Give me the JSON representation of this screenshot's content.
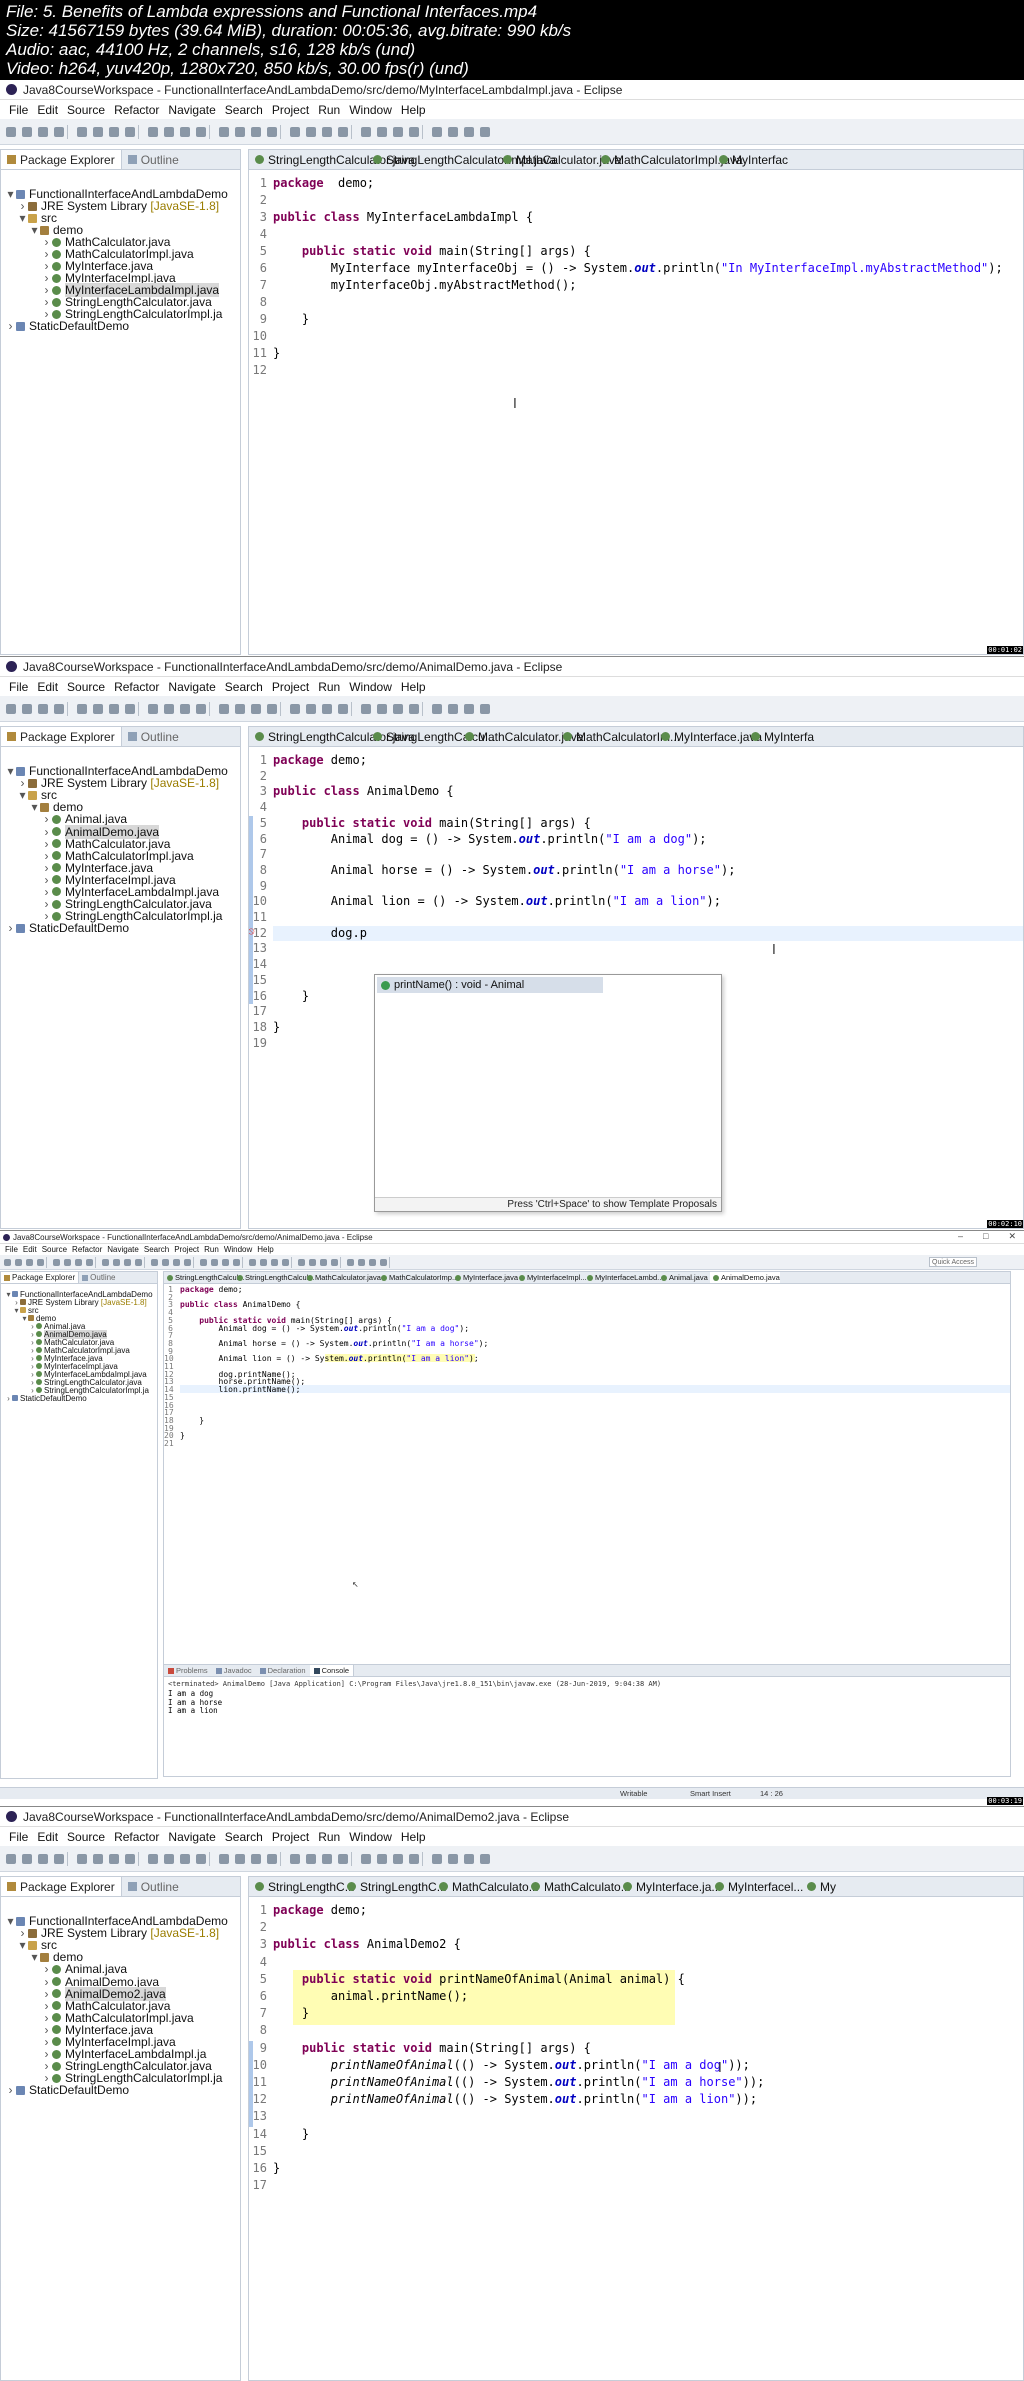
{
  "header": {
    "file": "File: 5. Benefits of Lambda expressions and Functional Interfaces.mp4",
    "size": "Size: 41567159 bytes (39.64 MiB), duration: 00:05:36, avg.bitrate: 990 kb/s",
    "audio": "Audio: aac, 44100 Hz, 2 channels, s16, 128 kb/s (und)",
    "video": "Video: h264, yuv420p, 1280x720, 850 kb/s, 30.00 fps(r) (und)"
  },
  "menu": [
    "File",
    "Edit",
    "Source",
    "Refactor",
    "Navigate",
    "Search",
    "Project",
    "Run",
    "Window",
    "Help"
  ],
  "views": {
    "package_explorer": "Package Explorer",
    "outline": "Outline",
    "problems": "Problems",
    "javadoc": "Javadoc",
    "declaration": "Declaration",
    "console": "Console"
  },
  "frame1": {
    "title": "Java8CourseWorkspace - FunctionalInterfaceAndLambdaDemo/src/demo/MyInterfaceLambdaImpl.java - Eclipse",
    "tabs": [
      "StringLengthCalculator.java",
      "StringLengthCalculatorImpl.java",
      "MathCalculator.java",
      "MathCalculatorImpl.java",
      "MyInterfac"
    ],
    "tree": [
      {
        "d": 0,
        "arrow": "▾",
        "icon": "proj",
        "label": "FunctionalInterfaceAndLambdaDemo"
      },
      {
        "d": 1,
        "arrow": "›",
        "icon": "lib",
        "label": "JRE System Library",
        "sub": "[JavaSE-1.8]"
      },
      {
        "d": 1,
        "arrow": "▾",
        "icon": "src",
        "label": "src"
      },
      {
        "d": 2,
        "arrow": "▾",
        "icon": "pkg",
        "label": "demo"
      },
      {
        "d": 3,
        "arrow": "›",
        "icon": "java",
        "label": "MathCalculator.java"
      },
      {
        "d": 3,
        "arrow": "›",
        "icon": "java",
        "label": "MathCalculatorImpl.java"
      },
      {
        "d": 3,
        "arrow": "›",
        "icon": "java",
        "label": "MyInterface.java"
      },
      {
        "d": 3,
        "arrow": "›",
        "icon": "java",
        "label": "MyInterfaceImpl.java"
      },
      {
        "d": 3,
        "arrow": "›",
        "icon": "java",
        "label": "MyInterfaceLambdaImpl.java",
        "sel": true
      },
      {
        "d": 3,
        "arrow": "›",
        "icon": "java",
        "label": "StringLengthCalculator.java"
      },
      {
        "d": 3,
        "arrow": "›",
        "icon": "java",
        "label": "StringLengthCalculatorImpl.ja"
      },
      {
        "d": 0,
        "arrow": "›",
        "icon": "proj",
        "label": "StaticDefaultDemo"
      }
    ],
    "code": [
      [
        "1",
        [
          [
            "kw",
            "package"
          ],
          [
            "",
            "  demo;"
          ]
        ]
      ],
      [
        "2",
        []
      ],
      [
        "3",
        [
          [
            "kw",
            "public class"
          ],
          [
            "",
            " MyInterfaceLambdaImpl {"
          ]
        ]
      ],
      [
        "4",
        []
      ],
      [
        "5",
        [
          [
            "",
            "    "
          ],
          [
            "kw",
            "public static void"
          ],
          [
            "",
            " main(String[] args) {"
          ]
        ]
      ],
      [
        "6",
        [
          [
            "",
            "        MyInterface myInterfaceObj = () -> System."
          ],
          [
            "fi",
            "out"
          ],
          [
            "",
            ".println("
          ],
          [
            "st",
            "\"In MyInterfaceImpl.myAbstractMethod\""
          ],
          [
            "",
            ");"
          ]
        ]
      ],
      [
        "7",
        [
          [
            "",
            "        myInterfaceObj.myAbstractMethod();"
          ]
        ]
      ],
      [
        "8",
        []
      ],
      [
        "9",
        [
          [
            "",
            "    }"
          ]
        ]
      ],
      [
        "10",
        []
      ],
      [
        "11",
        [
          [
            "",
            "}"
          ]
        ]
      ],
      [
        "12",
        []
      ]
    ],
    "timecode": "00:01:02"
  },
  "frame2": {
    "title": "Java8CourseWorkspace - FunctionalInterfaceAndLambdaDemo/src/demo/AnimalDemo.java - Eclipse",
    "tabs": [
      "StringLengthCalculator.java",
      "StringLengthCalcu...",
      "MathCalculator.java",
      "MathCalculatorIm...",
      "MyInterface.java",
      "MyInterfa"
    ],
    "tree": [
      {
        "d": 0,
        "arrow": "▾",
        "icon": "proj",
        "label": "FunctionalInterfaceAndLambdaDemo"
      },
      {
        "d": 1,
        "arrow": "›",
        "icon": "lib",
        "label": "JRE System Library",
        "sub": "[JavaSE-1.8]"
      },
      {
        "d": 1,
        "arrow": "▾",
        "icon": "src",
        "label": "src"
      },
      {
        "d": 2,
        "arrow": "▾",
        "icon": "pkg",
        "label": "demo"
      },
      {
        "d": 3,
        "arrow": "›",
        "icon": "java",
        "label": "Animal.java"
      },
      {
        "d": 3,
        "arrow": "›",
        "icon": "java",
        "label": "AnimalDemo.java",
        "sel": true
      },
      {
        "d": 3,
        "arrow": "›",
        "icon": "java",
        "label": "MathCalculator.java"
      },
      {
        "d": 3,
        "arrow": "›",
        "icon": "java",
        "label": "MathCalculatorImpl.java"
      },
      {
        "d": 3,
        "arrow": "›",
        "icon": "java",
        "label": "MyInterface.java"
      },
      {
        "d": 3,
        "arrow": "›",
        "icon": "java",
        "label": "MyInterfaceImpl.java"
      },
      {
        "d": 3,
        "arrow": "›",
        "icon": "java",
        "label": "MyInterfaceLambdaImpl.java"
      },
      {
        "d": 3,
        "arrow": "›",
        "icon": "java",
        "label": "StringLengthCalculator.java"
      },
      {
        "d": 3,
        "arrow": "›",
        "icon": "java",
        "label": "StringLengthCalculatorImpl.ja"
      },
      {
        "d": 0,
        "arrow": "›",
        "icon": "proj",
        "label": "StaticDefaultDemo"
      }
    ],
    "code": [
      [
        "1",
        [
          [
            "kw",
            "package"
          ],
          [
            "",
            " demo;"
          ]
        ]
      ],
      [
        "2",
        []
      ],
      [
        "3",
        [
          [
            "kw",
            "public class"
          ],
          [
            "",
            " AnimalDemo {"
          ]
        ]
      ],
      [
        "4",
        []
      ],
      [
        "5",
        [
          [
            "",
            "    "
          ],
          [
            "kw",
            "public static void"
          ],
          [
            "",
            " main(String[] args) {"
          ]
        ]
      ],
      [
        "6",
        [
          [
            "",
            "        Animal dog = () -> System."
          ],
          [
            "fi",
            "out"
          ],
          [
            "",
            ".println("
          ],
          [
            "st",
            "\"I am a dog\""
          ],
          [
            "",
            ");"
          ]
        ]
      ],
      [
        "7",
        []
      ],
      [
        "8",
        [
          [
            "",
            "        Animal horse = () -> System."
          ],
          [
            "fi",
            "out"
          ],
          [
            "",
            ".println("
          ],
          [
            "st",
            "\"I am a horse\""
          ],
          [
            "",
            ");"
          ]
        ]
      ],
      [
        "9",
        []
      ],
      [
        "10",
        [
          [
            "",
            "        Animal lion = () -> System."
          ],
          [
            "fi",
            "out"
          ],
          [
            "",
            ".println("
          ],
          [
            "st",
            "\"I am a lion\""
          ],
          [
            "",
            ");"
          ]
        ]
      ],
      [
        "11",
        []
      ],
      [
        "12",
        [
          [
            "",
            "        dog.p"
          ]
        ]
      ],
      [
        "13",
        []
      ],
      [
        "14",
        []
      ],
      [
        "15",
        []
      ],
      [
        "16",
        [
          [
            "",
            "    }"
          ]
        ]
      ],
      [
        "17",
        []
      ],
      [
        "18",
        [
          [
            "",
            "}"
          ]
        ]
      ],
      [
        "19",
        []
      ]
    ],
    "popup_item": "printName() : void - Animal",
    "popup_footer": "Press 'Ctrl+Space' to show Template Proposals",
    "timecode": "00:02:10"
  },
  "frame3": {
    "title": "Java8CourseWorkspace - FunctionalInterfaceAndLambdaDemo/src/demo/AnimalDemo.java - Eclipse",
    "quick_access": "Quick Access",
    "tabs": [
      "StringLengthCalcul...",
      "StringLengthCalcul...",
      "MathCalculator.java",
      "MathCalculatorImp...",
      "MyInterface.java",
      "MyInterfaceImpl...",
      "MyInterfaceLambd...",
      "Animal.java",
      "AnimalDemo.java"
    ],
    "tree": [
      {
        "d": 0,
        "arrow": "▾",
        "icon": "proj",
        "label": "FunctionalInterfaceAndLambdaDemo"
      },
      {
        "d": 1,
        "arrow": "›",
        "icon": "lib",
        "label": "JRE System Library",
        "sub": "[JavaSE-1.8]"
      },
      {
        "d": 1,
        "arrow": "▾",
        "icon": "src",
        "label": "src"
      },
      {
        "d": 2,
        "arrow": "▾",
        "icon": "pkg",
        "label": "demo"
      },
      {
        "d": 3,
        "arrow": "›",
        "icon": "java",
        "label": "Animal.java"
      },
      {
        "d": 3,
        "arrow": "›",
        "icon": "java",
        "label": "AnimalDemo.java",
        "sel": true
      },
      {
        "d": 3,
        "arrow": "›",
        "icon": "java",
        "label": "MathCalculator.java"
      },
      {
        "d": 3,
        "arrow": "›",
        "icon": "java",
        "label": "MathCalculatorImpl.java"
      },
      {
        "d": 3,
        "arrow": "›",
        "icon": "java",
        "label": "MyInterface.java"
      },
      {
        "d": 3,
        "arrow": "›",
        "icon": "java",
        "label": "MyInterfaceImpl.java"
      },
      {
        "d": 3,
        "arrow": "›",
        "icon": "java",
        "label": "MyInterfaceLambdaImpl.java"
      },
      {
        "d": 3,
        "arrow": "›",
        "icon": "java",
        "label": "StringLengthCalculator.java"
      },
      {
        "d": 3,
        "arrow": "›",
        "icon": "java",
        "label": "StringLengthCalculatorImpl.ja"
      },
      {
        "d": 0,
        "arrow": "›",
        "icon": "proj",
        "label": "StaticDefaultDemo"
      }
    ],
    "code": [
      [
        "1",
        [
          [
            "kw",
            "package"
          ],
          [
            "",
            " demo;"
          ]
        ]
      ],
      [
        "2",
        []
      ],
      [
        "3",
        [
          [
            "kw",
            "public class"
          ],
          [
            "",
            " AnimalDemo {"
          ]
        ]
      ],
      [
        "4",
        []
      ],
      [
        "5",
        [
          [
            "",
            "    "
          ],
          [
            "kw",
            "public static void"
          ],
          [
            "",
            " main(String[] args) {"
          ]
        ]
      ],
      [
        "6",
        [
          [
            "",
            "        Animal dog = () -> System."
          ],
          [
            "fi",
            "out"
          ],
          [
            "",
            ".println("
          ],
          [
            "st",
            "\"I am a dog\""
          ],
          [
            "",
            ");"
          ]
        ]
      ],
      [
        "7",
        []
      ],
      [
        "8",
        [
          [
            "",
            "        Animal horse = () -> System."
          ],
          [
            "fi",
            "out"
          ],
          [
            "",
            ".println("
          ],
          [
            "st",
            "\"I am a horse\""
          ],
          [
            "",
            ");"
          ]
        ]
      ],
      [
        "9",
        []
      ],
      [
        "10",
        [
          [
            "",
            "        Animal lion = () -> System."
          ],
          [
            "fi",
            "out"
          ],
          [
            "",
            ".println("
          ],
          [
            "st",
            "\"I am a lion\""
          ],
          [
            "",
            ");"
          ]
        ]
      ],
      [
        "11",
        []
      ],
      [
        "12",
        [
          [
            "",
            "        dog.printName();"
          ]
        ]
      ],
      [
        "13",
        [
          [
            "",
            "        horse.printName();"
          ]
        ]
      ],
      [
        "14",
        [
          [
            "",
            "        lion.printName();"
          ]
        ]
      ],
      [
        "15",
        []
      ],
      [
        "16",
        []
      ],
      [
        "17",
        []
      ],
      [
        "18",
        [
          [
            "",
            "    }"
          ]
        ]
      ],
      [
        "19",
        []
      ],
      [
        "20",
        [
          [
            "",
            "}"
          ]
        ]
      ],
      [
        "21",
        []
      ]
    ],
    "console_header": "<terminated> AnimalDemo [Java Application] C:\\Program Files\\Java\\jre1.8.0_151\\bin\\javaw.exe (28-Jun-2019, 9:04:38 AM)",
    "console_lines": [
      "I am a dog",
      "I am a horse",
      "I am a lion"
    ],
    "status": [
      "Writable",
      "Smart Insert",
      "14 : 26"
    ],
    "timecode": "00:03:19"
  },
  "frame4": {
    "title": "Java8CourseWorkspace - FunctionalInterfaceAndLambdaDemo/src/demo/AnimalDemo2.java - Eclipse",
    "tabs": [
      "StringLengthC...",
      "StringLengthC...",
      "MathCalculato...",
      "MathCalculato...",
      "MyInterface.ja...",
      "MyInterfacel...",
      "My"
    ],
    "tree": [
      {
        "d": 0,
        "arrow": "▾",
        "icon": "proj",
        "label": "FunctionalInterfaceAndLambdaDemo"
      },
      {
        "d": 1,
        "arrow": "›",
        "icon": "lib",
        "label": "JRE System Library",
        "sub": "[JavaSE-1.8]"
      },
      {
        "d": 1,
        "arrow": "▾",
        "icon": "src",
        "label": "src"
      },
      {
        "d": 2,
        "arrow": "▾",
        "icon": "pkg",
        "label": "demo"
      },
      {
        "d": 3,
        "arrow": "›",
        "icon": "java",
        "label": "Animal.java"
      },
      {
        "d": 3,
        "arrow": "›",
        "icon": "java",
        "label": "AnimalDemo.java"
      },
      {
        "d": 3,
        "arrow": "›",
        "icon": "java",
        "label": "AnimalDemo2.java",
        "sel": true
      },
      {
        "d": 3,
        "arrow": "›",
        "icon": "java",
        "label": "MathCalculator.java"
      },
      {
        "d": 3,
        "arrow": "›",
        "icon": "java",
        "label": "MathCalculatorImpl.java"
      },
      {
        "d": 3,
        "arrow": "›",
        "icon": "java",
        "label": "MyInterface.java"
      },
      {
        "d": 3,
        "arrow": "›",
        "icon": "java",
        "label": "MyInterfaceImpl.java"
      },
      {
        "d": 3,
        "arrow": "›",
        "icon": "java",
        "label": "MyInterfaceLambdaImpl.ja"
      },
      {
        "d": 3,
        "arrow": "›",
        "icon": "java",
        "label": "StringLengthCalculator.java"
      },
      {
        "d": 3,
        "arrow": "›",
        "icon": "java",
        "label": "StringLengthCalculatorImpl.ja"
      },
      {
        "d": 0,
        "arrow": "›",
        "icon": "proj",
        "label": "StaticDefaultDemo"
      }
    ],
    "code": [
      [
        "1",
        [
          [
            "kw",
            "package"
          ],
          [
            "",
            " demo;"
          ]
        ]
      ],
      [
        "2",
        []
      ],
      [
        "3",
        [
          [
            "kw",
            "public class"
          ],
          [
            "",
            " AnimalDemo2 {"
          ]
        ]
      ],
      [
        "4",
        []
      ],
      [
        "5",
        [
          [
            "",
            "    "
          ],
          [
            "kw",
            "public static void"
          ],
          [
            "",
            " printNameOfAnimal(Animal animal) {"
          ]
        ]
      ],
      [
        "6",
        [
          [
            "",
            "        animal.printName();"
          ]
        ]
      ],
      [
        "7",
        [
          [
            "",
            "    }"
          ]
        ]
      ],
      [
        "8",
        []
      ],
      [
        "9",
        [
          [
            "",
            "    "
          ],
          [
            "kw",
            "public static void"
          ],
          [
            "",
            " main(String[] args) {"
          ]
        ]
      ],
      [
        "10",
        [
          [
            "",
            "        "
          ],
          [
            "it",
            "printNameOfAnimal"
          ],
          [
            "",
            "(() -> System."
          ],
          [
            "fi",
            "out"
          ],
          [
            "",
            ".println("
          ],
          [
            "st",
            "\"I am a dog\""
          ],
          [
            "",
            "));"
          ]
        ]
      ],
      [
        "11",
        [
          [
            "",
            "        "
          ],
          [
            "it",
            "printNameOfAnimal"
          ],
          [
            "",
            "(() -> System."
          ],
          [
            "fi",
            "out"
          ],
          [
            "",
            ".println("
          ],
          [
            "st",
            "\"I am a horse\""
          ],
          [
            "",
            "));"
          ]
        ]
      ],
      [
        "12",
        [
          [
            "",
            "        "
          ],
          [
            "it",
            "printNameOfAnimal"
          ],
          [
            "",
            "(() -> System."
          ],
          [
            "fi",
            "out"
          ],
          [
            "",
            ".println("
          ],
          [
            "st",
            "\"I am a lion\""
          ],
          [
            "",
            "));"
          ]
        ]
      ],
      [
        "13",
        []
      ],
      [
        "14",
        [
          [
            "",
            "    }"
          ]
        ]
      ],
      [
        "15",
        []
      ],
      [
        "16",
        [
          [
            "",
            "}"
          ]
        ]
      ],
      [
        "17",
        []
      ]
    ]
  }
}
